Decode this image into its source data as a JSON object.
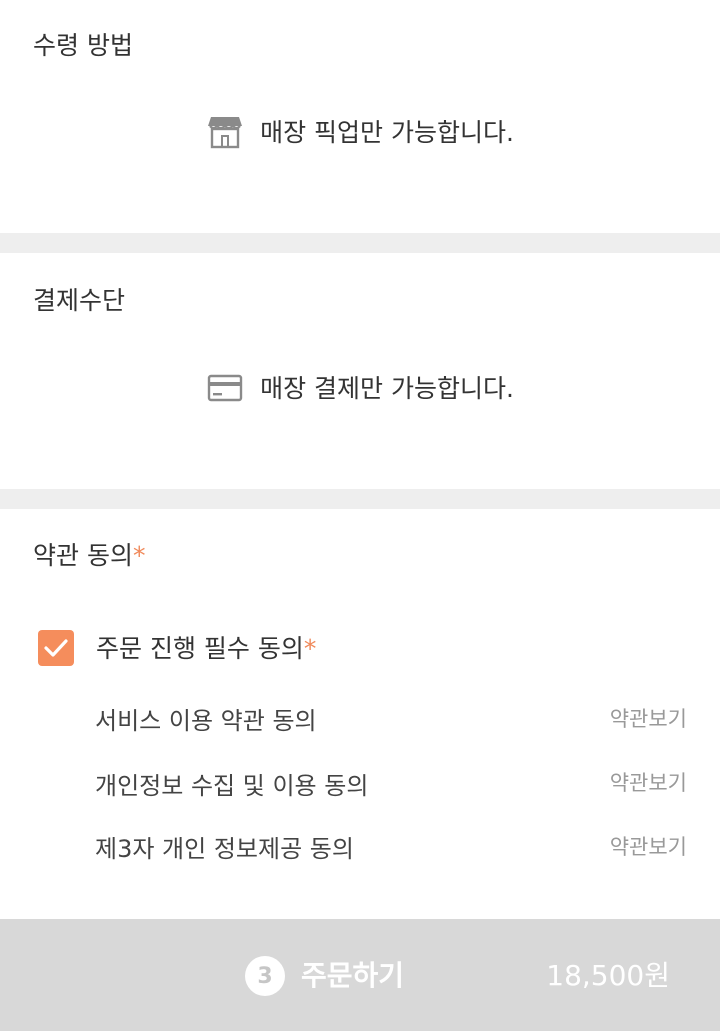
{
  "pickup": {
    "title": "수령 방법",
    "info": "매장 픽업만 가능합니다.",
    "icon": "store-icon"
  },
  "payment": {
    "title": "결제수단",
    "info": "매장 결제만 가능합니다.",
    "icon": "credit-card-icon"
  },
  "terms": {
    "title": "약관 동의",
    "required_mark": "*",
    "master_label": "주문 진행 필수 동의",
    "master_checked": true,
    "items": [
      {
        "label": "서비스 이용 약관 동의",
        "link": "약관보기"
      },
      {
        "label": "개인정보 수집 및 이용 동의",
        "link": "약관보기"
      },
      {
        "label": "제3자 개인 정보제공 동의",
        "link": "약관보기"
      }
    ]
  },
  "order": {
    "count": "3",
    "label": "주문하기",
    "price": "18,500원"
  },
  "colors": {
    "accent": "#f58d5c",
    "divider": "#eeeeee",
    "order_bar": "#d8d8d8",
    "link": "#999999"
  }
}
